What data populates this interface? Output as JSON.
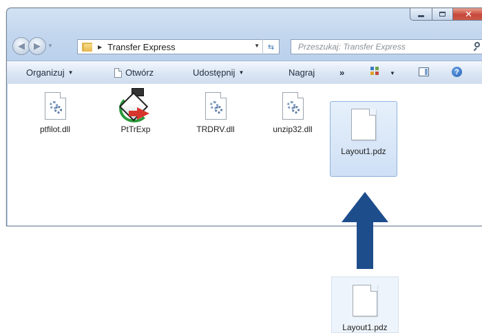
{
  "window": {
    "title_buttons": {
      "minimize": "minimize-icon",
      "maximize": "maximize-icon",
      "close": "close-icon"
    },
    "close_glyph": "✕"
  },
  "nav": {
    "back_icon": "back-arrow-icon",
    "forward_icon": "forward-arrow-icon",
    "address_path": "Transfer Express",
    "search_placeholder": "Przeszukaj: Transfer Express"
  },
  "toolbar": {
    "organize": "Organizuj",
    "open": "Otwórz",
    "share": "Udostępnij",
    "burn": "Nagraj",
    "more": "»"
  },
  "files": [
    {
      "name": "ptfilot.dll",
      "icon": "dll-gear-icon"
    },
    {
      "name": "PtTrExp",
      "icon": "transfer-express-app-icon"
    },
    {
      "name": "TRDRV.dll",
      "icon": "dll-gear-icon"
    },
    {
      "name": "unzip32.dll",
      "icon": "dll-gear-icon"
    },
    {
      "name": "Layout1.pdz",
      "icon": "blank-document-icon",
      "selected": true
    }
  ],
  "dragged_file": {
    "name": "Layout1.pdz",
    "icon": "blank-document-icon"
  },
  "colors": {
    "arrow": "#1e4d8c",
    "selection": "#cfe0f5"
  }
}
